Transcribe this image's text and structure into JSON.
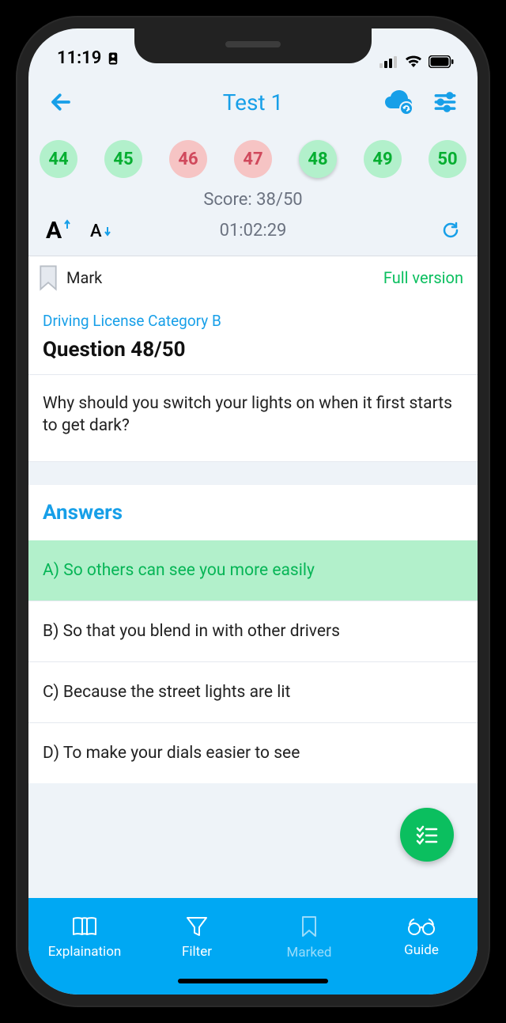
{
  "status": {
    "time": "11:19"
  },
  "header": {
    "title": "Test 1"
  },
  "pills": [
    {
      "num": "44",
      "state": "correct"
    },
    {
      "num": "45",
      "state": "correct"
    },
    {
      "num": "46",
      "state": "wrong"
    },
    {
      "num": "47",
      "state": "wrong"
    },
    {
      "num": "48",
      "state": "current"
    },
    {
      "num": "49",
      "state": "correct"
    },
    {
      "num": "50",
      "state": "correct"
    }
  ],
  "score_label": "Score: 38/50",
  "timer": "01:02:29",
  "mark_label": "Mark",
  "full_version_label": "Full version",
  "category": "Driving License Category B",
  "question_number": "Question 48/50",
  "question_text": "Why should you switch your lights on when it first starts to get dark?",
  "answers_header": "Answers",
  "answers": [
    {
      "text": "A) So others can see you more easily",
      "correct": true
    },
    {
      "text": "B) So that you blend in with other drivers",
      "correct": false
    },
    {
      "text": "C) Because the street lights are lit",
      "correct": false
    },
    {
      "text": "D) To make your dials easier to see",
      "correct": false
    }
  ],
  "tabs": {
    "explanation": "Explaination",
    "filter": "Filter",
    "marked": "Marked",
    "guide": "Guide"
  }
}
